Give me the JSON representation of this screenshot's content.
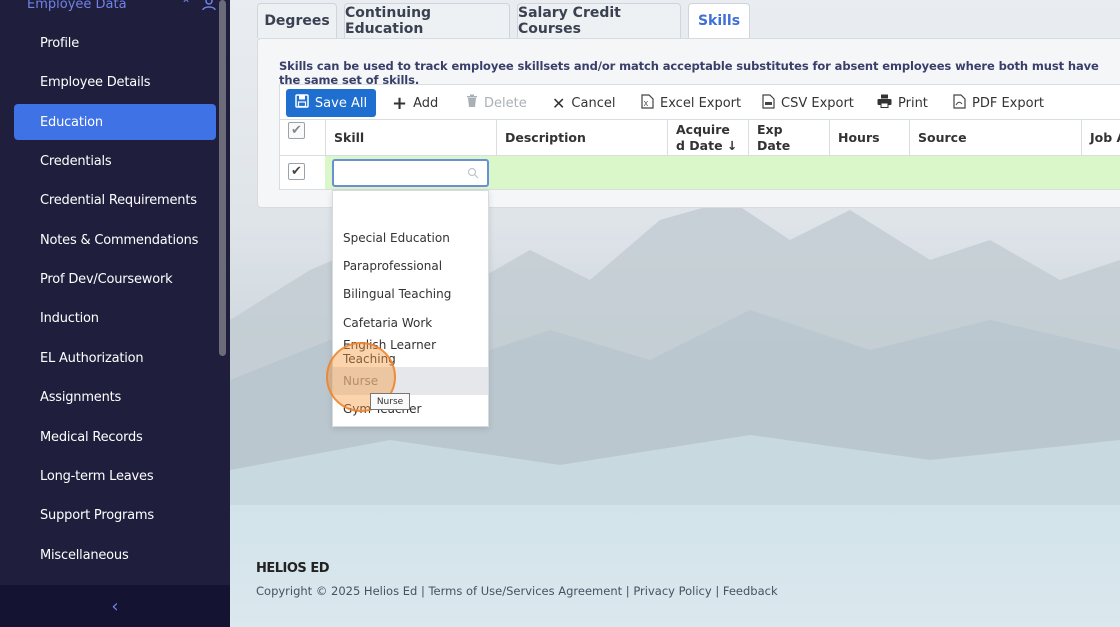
{
  "sidebar": {
    "header": "Employee Data",
    "items": [
      {
        "label": "Profile"
      },
      {
        "label": "Employee Details"
      },
      {
        "label": "Education"
      },
      {
        "label": "Credentials"
      },
      {
        "label": "Credential Requirements"
      },
      {
        "label": "Notes & Commendations"
      },
      {
        "label": "Prof Dev/Coursework"
      },
      {
        "label": "Induction"
      },
      {
        "label": "EL Authorization"
      },
      {
        "label": "Assignments"
      },
      {
        "label": "Medical Records"
      },
      {
        "label": "Long-term Leaves"
      },
      {
        "label": "Support Programs"
      },
      {
        "label": "Miscellaneous"
      }
    ],
    "active_item": "Education",
    "collapse_glyph": "‹"
  },
  "tabs": [
    {
      "label": "Degrees"
    },
    {
      "label": "Continuing Education"
    },
    {
      "label": "Salary Credit Courses"
    },
    {
      "label": "Skills"
    }
  ],
  "active_tab": "Skills",
  "hint": "Skills can be used to track employee skillsets and/or match acceptable substitutes for absent employees where both must have the same set of skills.",
  "toolbar": {
    "save_all": "Save All",
    "add": "Add",
    "delete": "Delete",
    "cancel": "Cancel",
    "excel_export": "Excel Export",
    "csv_export": "CSV Export",
    "print": "Print",
    "pdf_export": "PDF Export"
  },
  "grid": {
    "columns": {
      "skill": "Skill",
      "description": "Description",
      "acquired_date_l1": "Acquire",
      "acquired_date_l2": "d Date ↓",
      "exp_date_l1": "Exp",
      "exp_date_l2": "Date",
      "hours": "Hours",
      "source": "Source",
      "job_a": "Job A"
    },
    "edit_row": {
      "skill_value": "",
      "checked": true
    }
  },
  "dropdown": {
    "options": [
      {
        "label": "Special Education"
      },
      {
        "label": "Paraprofessional"
      },
      {
        "label": "Bilingual Teaching"
      },
      {
        "label": "Cafetaria Work"
      },
      {
        "label": "English Learner Teaching"
      },
      {
        "label": "Nurse"
      },
      {
        "label": "Gym Teacher"
      }
    ],
    "hovered": "Nurse",
    "tooltip": "Nurse"
  },
  "footer": {
    "logo": "HELIOS ED",
    "copyright": "Copyright © 2025 Helios Ed",
    "links": [
      {
        "label": "Terms of Use/Services Agreement"
      },
      {
        "label": "Privacy Policy"
      },
      {
        "label": "Feedback"
      }
    ],
    "separator": " | "
  },
  "colors": {
    "sidebar_bg": "#1f1e3d",
    "active_nav": "#3f72e4",
    "primary_button": "#1f6fd0",
    "edit_row_bg": "#d9f7c8",
    "cursor_highlight": "#f5963c"
  }
}
